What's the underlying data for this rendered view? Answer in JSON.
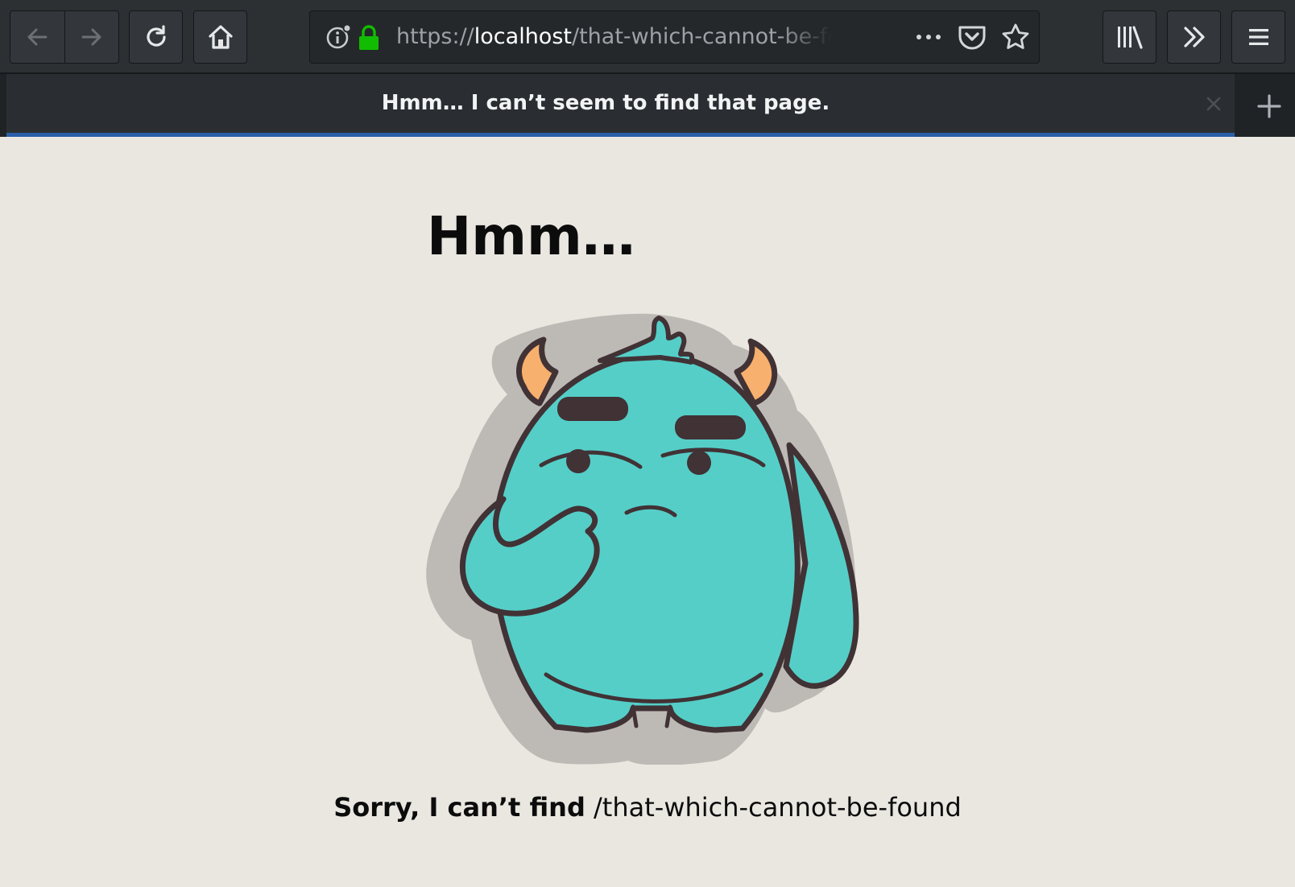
{
  "browser": {
    "url": {
      "scheme": "https://",
      "host": "localhost",
      "path": "/that-which-cannot-be-found"
    },
    "tab": {
      "title": "Hmm… I can’t seem to find that page."
    },
    "icons": {
      "back": "back-arrow-icon",
      "forward": "forward-arrow-icon",
      "reload": "reload-icon",
      "home": "home-icon",
      "site_info": "info-icon",
      "secure": "lock-icon",
      "page_actions": "more-dots-icon",
      "pocket": "pocket-icon",
      "bookmark": "star-icon",
      "library": "library-icon",
      "overflow": "chevron-double-right-icon",
      "menu": "hamburger-menu-icon",
      "tab_close": "close-icon",
      "new_tab": "plus-icon"
    },
    "colors": {
      "toolbar": "#2c3033",
      "tab_active_indicator": "#2a5fa8",
      "secure_lock": "#12bc00"
    }
  },
  "page": {
    "heading": "Hmm…",
    "illustration": "thinking-monster",
    "message_prefix": "Sorry, I can’t find",
    "message_path": "/that-which-cannot-be-found",
    "colors": {
      "background": "#eae7e1",
      "monster_body": "#55cec8",
      "monster_horns": "#f7b06d",
      "outline": "#413235"
    }
  }
}
